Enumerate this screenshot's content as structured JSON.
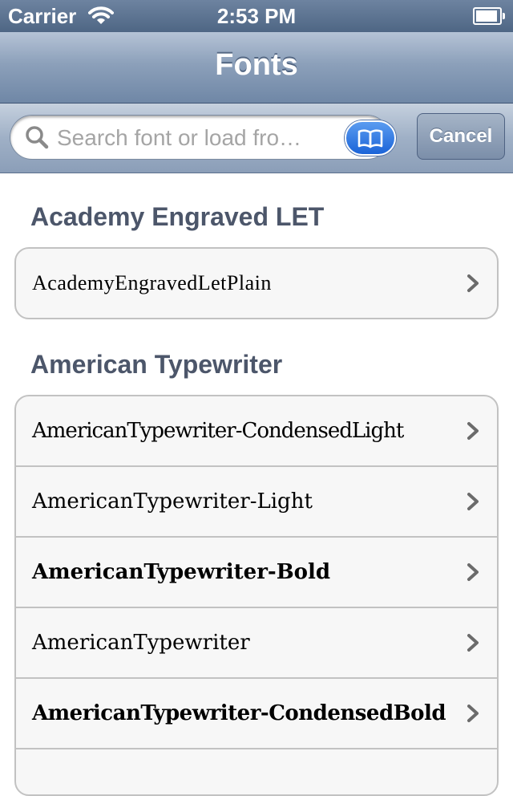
{
  "status_bar": {
    "carrier": "Carrier",
    "time": "2:53 PM",
    "battery_level": 0.9
  },
  "nav": {
    "title": "Fonts"
  },
  "search": {
    "placeholder": "Search font or load fro…",
    "value": "",
    "cancel_label": "Cancel"
  },
  "sections": [
    {
      "header": "Academy Engraved LET",
      "rows": [
        {
          "label": "AcademyEngravedLetPlain"
        }
      ]
    },
    {
      "header": "American Typewriter",
      "rows": [
        {
          "label": "AmericanTypewriter-CondensedLight"
        },
        {
          "label": "AmericanTypewriter-Light"
        },
        {
          "label": "AmericanTypewriter-Bold"
        },
        {
          "label": "AmericanTypewriter"
        },
        {
          "label": "AmericanTypewriter-CondensedBold"
        },
        {
          "label": ""
        }
      ]
    }
  ],
  "colors": {
    "nav_gradient_top": "#b5c3d6",
    "nav_gradient_bottom": "#6f87a6",
    "section_header": "#4c566a",
    "bookmark_button": "#1b64d8"
  }
}
